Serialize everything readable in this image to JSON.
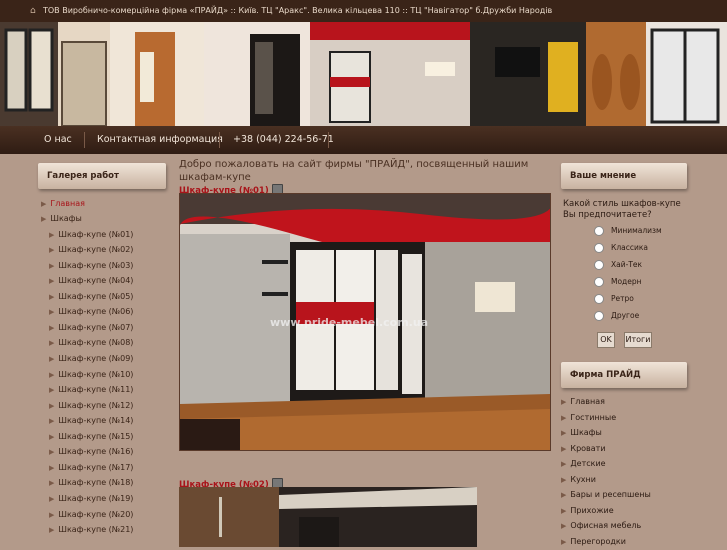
{
  "topbar": {
    "text": "ТОВ Виробничо-комерційна фірма «ПРАЙД» :: Київ. ТЦ \"Аракс\". Велика кільцева 110 :: ТЦ \"Навігатор\" б.Дружби Народів"
  },
  "nav": {
    "about": "О нас",
    "contact": "Контактная информация",
    "phone": "+38 (044) 224-56-71"
  },
  "left": {
    "title": "Галерея работ",
    "items": [
      "Главная",
      "Шкафы",
      "Шкаф-купе (№01)",
      "Шкаф-купе (№02)",
      "Шкаф-купе (№03)",
      "Шкаф-купе (№04)",
      "Шкаф-купе (№05)",
      "Шкаф-купе (№06)",
      "Шкаф-купе (№07)",
      "Шкаф-купе (№08)",
      "Шкаф-купе (№09)",
      "Шкаф-купе (№10)",
      "Шкаф-купе (№11)",
      "Шкаф-купе (№12)",
      "Шкаф-купе (№14)",
      "Шкаф-купе (№15)",
      "Шкаф-купе (№16)",
      "Шкаф-купе (№17)",
      "Шкаф-купе (№18)",
      "Шкаф-купе (№19)",
      "Шкаф-купе (№20)",
      "Шкаф-купе (№21)"
    ]
  },
  "center": {
    "welcome": "Добро пожаловать на сайт фирмы \"ПРАЙД\", посвященный нашим шкафам-купе",
    "p1_title": "Шкаф-купе (№01)",
    "p2_title": "Шкаф-купе (№02)",
    "watermark": "www.pride-mebel.com.ua"
  },
  "poll": {
    "title": "Ваше мнение",
    "question": "Какой стиль шкафов-купе Вы предпочитаете?",
    "options": [
      "Минимализм",
      "Классика",
      "Хай-Тек",
      "Модерн",
      "Ретро",
      "Другое"
    ],
    "ok": "OK",
    "results": "Итоги"
  },
  "firm": {
    "title": "Фирма ПРАЙД",
    "items": [
      "Главная",
      "Гостинные",
      "Шкафы",
      "Кровати",
      "Детские",
      "Кухни",
      "Бары и ресепшены",
      "Прихожие",
      "Офисная мебель",
      "Перегородки"
    ]
  },
  "colors": {
    "accent": "#a8141a",
    "dark": "#3a2418",
    "bg": "#b39a8a"
  }
}
